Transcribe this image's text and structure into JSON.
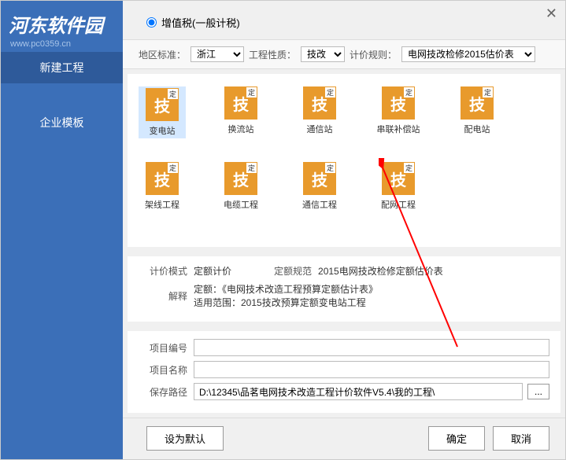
{
  "logo": {
    "text": "河东软件园",
    "url": "www.pc0359.cn"
  },
  "sidebar": {
    "items": [
      {
        "label": "新建工程"
      },
      {
        "label": "企业模板"
      }
    ]
  },
  "header": {
    "tax_label": "增值税(一般计税)"
  },
  "filters": {
    "region_label": "地区标准：",
    "region_value": "浙江",
    "nature_label": "工程性质：",
    "nature_value": "技改",
    "rule_label": "计价规则：",
    "rule_value": "电网技改检修2015估价表"
  },
  "icons": {
    "char": "技",
    "corner": "定",
    "items": [
      {
        "label": "变电站"
      },
      {
        "label": "换流站"
      },
      {
        "label": "通信站"
      },
      {
        "label": "串联补偿站"
      },
      {
        "label": "配电站"
      },
      {
        "label": "架线工程"
      },
      {
        "label": "电缆工程"
      },
      {
        "label": "通信工程"
      },
      {
        "label": "配网工程"
      }
    ]
  },
  "form": {
    "mode_label": "计价模式",
    "mode_value": "定额计价",
    "spec_label": "定额规范",
    "spec_value": "2015电网技改检修定额估价表",
    "explain_label": "解释",
    "explain_line1": "定额：《电网技术改造工程预算定额估计表》",
    "explain_line2": "适用范围：2015技改预算定额变电站工程",
    "proj_no_label": "项目编号",
    "proj_no_value": "",
    "proj_name_label": "项目名称",
    "proj_name_value": "",
    "path_label": "保存路径",
    "path_value": "D:\\12345\\品茗电网技术改造工程计价软件V5.4\\我的工程\\",
    "browse": "..."
  },
  "footer": {
    "default_btn": "设为默认",
    "ok_btn": "确定",
    "cancel_btn": "取消"
  }
}
